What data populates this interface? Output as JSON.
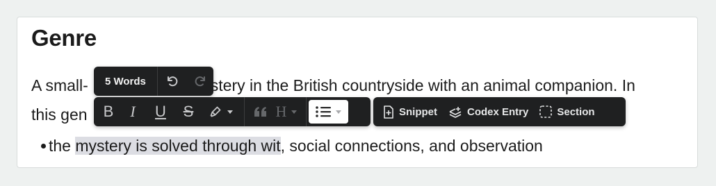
{
  "section": {
    "title": "Genre"
  },
  "paragraph": {
    "line1_before": "A small-",
    "line1_after": "stery in the British countryside with an animal companion. In",
    "line2_before": "this gen"
  },
  "bullets": [
    {
      "lead": "the ",
      "highlighted": "mystery is solved through wit",
      "rest": ", social connections, and observation"
    }
  ],
  "word_toolbar": {
    "word_count": "5 Words"
  },
  "format_toolbar": {
    "bold_label": "B",
    "italic_label": "I",
    "underline_label": "U",
    "strike_label": "S",
    "heading_label": "H"
  },
  "insert_toolbar": {
    "snippet_label": "Snippet",
    "codex_label": "Codex Entry",
    "section_label": "Section"
  },
  "colors": {
    "toolbar_bg": "#1f2021",
    "selection_highlight": "#dcdde3",
    "page_bg": "#eef1f0"
  },
  "icons": [
    "undo-icon",
    "redo-icon",
    "highlighter-icon",
    "quote-icon",
    "bullet-list-icon",
    "snippet-icon",
    "codex-entry-icon",
    "section-icon"
  ]
}
